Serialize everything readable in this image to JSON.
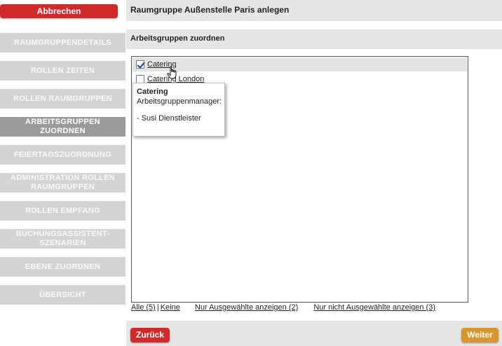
{
  "sidebar": {
    "cancel_label": "Abbrechen",
    "items": [
      {
        "label": "RAUMGRUPPENDETAILS",
        "active": false
      },
      {
        "label": "ROLLEN ZEITEN",
        "active": false
      },
      {
        "label": "ROLLEN RAUMGRUPPEN",
        "active": false
      },
      {
        "label": "ARBEITSGRUPPEN ZUORDNEN",
        "active": true
      },
      {
        "label": "FEIERTAGSZUORDNUNG",
        "active": false
      },
      {
        "label": "ADMINISTRATION ROLLEN RAUMGRUPPEN",
        "active": false
      },
      {
        "label": "ROLLEN EMPFANG",
        "active": false
      },
      {
        "label": "BUCHUNGSASSISTENT-SZENARIEN",
        "active": false
      },
      {
        "label": "EBENE ZUORDNEN",
        "active": false
      },
      {
        "label": "ÜBERSICHT",
        "active": false
      }
    ]
  },
  "header": {
    "title": "Raumgruppe Außenstelle Paris anlegen"
  },
  "section": {
    "title": "Arbeitsgruppen zuordnen"
  },
  "list": {
    "items": [
      {
        "label": "Catering",
        "checked": true
      },
      {
        "label": "Catering London",
        "checked": false
      }
    ]
  },
  "tooltip": {
    "title": "Catering",
    "role_label": "Arbeitsgruppenmanager:",
    "member": "- Susi Dienstleister"
  },
  "links": {
    "all": "Alle (5)",
    "separator": "|",
    "none": "Keine",
    "show_selected": "Nur Ausgewählte anzeigen (2)",
    "show_unselected": "Nur nicht Ausgewählte anzeigen (3)"
  },
  "footer": {
    "back_label": "Zurück",
    "next_label": "Weiter"
  },
  "colors": {
    "primary_red": "#d22a2a",
    "next_orange": "#d9962d",
    "nav_gray": "#d4d4d4",
    "nav_active": "#9a9a9a"
  }
}
